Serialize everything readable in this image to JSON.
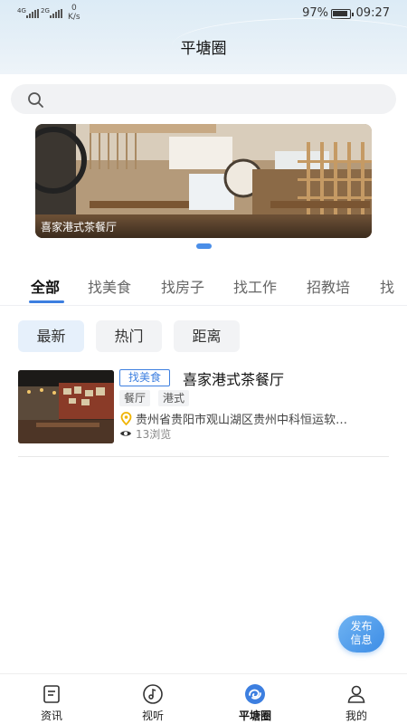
{
  "status_bar": {
    "signal1_label": "4G",
    "signal2_label": "2G",
    "net_speed_value": "0",
    "net_speed_unit": "K/s",
    "battery_pct": "97%",
    "time": "09:27"
  },
  "header": {
    "title": "平塘圈"
  },
  "search": {
    "placeholder": ""
  },
  "banner": {
    "caption": "喜家港式茶餐厅",
    "pages": 1,
    "current_page": 1
  },
  "category_tabs": [
    {
      "label": "全部",
      "active": true
    },
    {
      "label": "找美食",
      "active": false
    },
    {
      "label": "找房子",
      "active": false
    },
    {
      "label": "找工作",
      "active": false
    },
    {
      "label": "招教培",
      "active": false
    },
    {
      "label": "找",
      "active": false
    }
  ],
  "sort_tabs": [
    {
      "label": "最新",
      "active": true
    },
    {
      "label": "热门",
      "active": false
    },
    {
      "label": "距离",
      "active": false
    }
  ],
  "listings": [
    {
      "category": "找美食",
      "title": "喜家港式茶餐厅",
      "tags": [
        "餐厅",
        "港式"
      ],
      "address": "贵州省贵阳市观山湖区贵州中科恒运软…",
      "views": "13浏览"
    }
  ],
  "fab": {
    "line1": "发布",
    "line2": "信息"
  },
  "bottom_nav": [
    {
      "label": "资讯",
      "icon": "news-icon",
      "active": false
    },
    {
      "label": "视听",
      "icon": "music-icon",
      "active": false
    },
    {
      "label": "平塘圈",
      "icon": "circle-icon",
      "active": true
    },
    {
      "label": "我的",
      "icon": "profile-icon",
      "active": false
    }
  ],
  "colors": {
    "accent": "#3d7fe0",
    "fab": "#4a96e8",
    "badge": "#3d7fe0"
  }
}
